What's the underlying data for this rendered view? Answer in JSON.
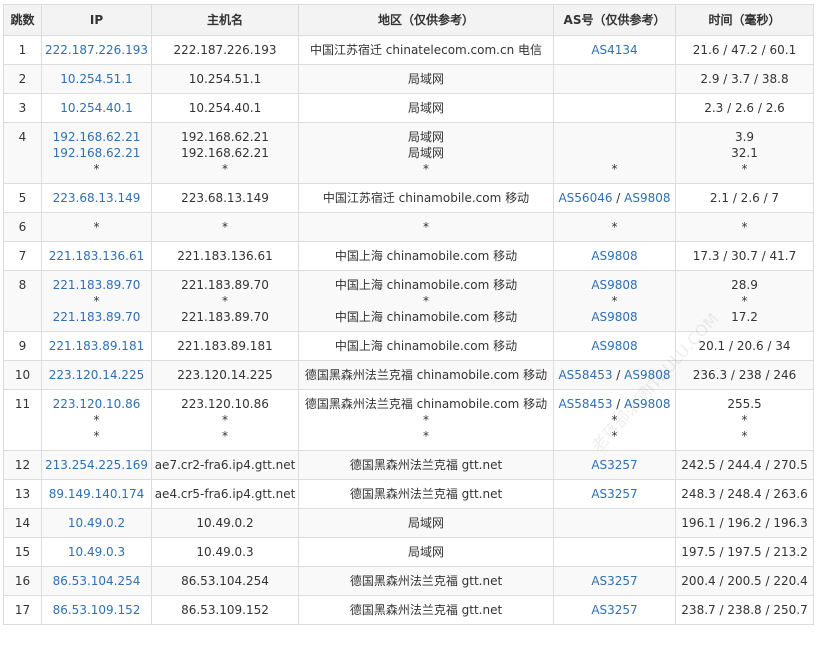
{
  "headers": [
    "跳数",
    "IP",
    "主机名",
    "地区（仅供参考）",
    "AS号（仅供参考）",
    "时间（毫秒）"
  ],
  "rows": [
    {
      "hop": "1",
      "ip": [
        "222.187.226.193"
      ],
      "host": [
        "222.187.226.193"
      ],
      "region": [
        "中国江苏宿迁 chinatelecom.com.cn 电信"
      ],
      "as": [
        [
          "AS4134"
        ]
      ],
      "time": [
        "21.6 / 47.2 / 60.1"
      ]
    },
    {
      "hop": "2",
      "ip": [
        "10.254.51.1"
      ],
      "host": [
        "10.254.51.1"
      ],
      "region": [
        "局域网"
      ],
      "as": [
        []
      ],
      "time": [
        "2.9 / 3.7 / 38.8"
      ]
    },
    {
      "hop": "3",
      "ip": [
        "10.254.40.1"
      ],
      "host": [
        "10.254.40.1"
      ],
      "region": [
        "局域网"
      ],
      "as": [
        []
      ],
      "time": [
        "2.3 / 2.6 / 2.6"
      ]
    },
    {
      "hop": "4",
      "ip": [
        "192.168.62.21",
        "192.168.62.21",
        "*"
      ],
      "host": [
        "192.168.62.21",
        "192.168.62.21",
        "*"
      ],
      "region": [
        "局域网",
        "局域网",
        "*"
      ],
      "as": [
        [],
        [],
        [
          "*"
        ]
      ],
      "time": [
        "3.9",
        "32.1",
        "*"
      ]
    },
    {
      "hop": "5",
      "ip": [
        "223.68.13.149"
      ],
      "host": [
        "223.68.13.149"
      ],
      "region": [
        "中国江苏宿迁 chinamobile.com 移动"
      ],
      "as": [
        [
          "AS56046",
          "AS9808"
        ]
      ],
      "time": [
        "2.1 / 2.6 / 7"
      ]
    },
    {
      "hop": "6",
      "ip": [
        "*"
      ],
      "host": [
        "*"
      ],
      "region": [
        "*"
      ],
      "as": [
        [
          "*"
        ]
      ],
      "time": [
        "*"
      ]
    },
    {
      "hop": "7",
      "ip": [
        "221.183.136.61"
      ],
      "host": [
        "221.183.136.61"
      ],
      "region": [
        "中国上海 chinamobile.com 移动"
      ],
      "as": [
        [
          "AS9808"
        ]
      ],
      "time": [
        "17.3 / 30.7 / 41.7"
      ]
    },
    {
      "hop": "8",
      "ip": [
        "221.183.89.70",
        "*",
        "221.183.89.70"
      ],
      "host": [
        "221.183.89.70",
        "*",
        "221.183.89.70"
      ],
      "region": [
        "中国上海 chinamobile.com 移动",
        "*",
        "中国上海 chinamobile.com 移动"
      ],
      "as": [
        [
          "AS9808"
        ],
        [
          "*"
        ],
        [
          "AS9808"
        ]
      ],
      "time": [
        "28.9",
        "*",
        "17.2"
      ]
    },
    {
      "hop": "9",
      "ip": [
        "221.183.89.181"
      ],
      "host": [
        "221.183.89.181"
      ],
      "region": [
        "中国上海 chinamobile.com 移动"
      ],
      "as": [
        [
          "AS9808"
        ]
      ],
      "time": [
        "20.1 / 20.6 / 34"
      ]
    },
    {
      "hop": "10",
      "ip": [
        "223.120.14.225"
      ],
      "host": [
        "223.120.14.225"
      ],
      "region": [
        "德国黑森州法兰克福 chinamobile.com 移动"
      ],
      "as": [
        [
          "AS58453",
          "AS9808"
        ]
      ],
      "time": [
        "236.3 / 238 / 246"
      ]
    },
    {
      "hop": "11",
      "ip": [
        "223.120.10.86",
        "*",
        "*"
      ],
      "host": [
        "223.120.10.86",
        "*",
        "*"
      ],
      "region": [
        "德国黑森州法兰克福 chinamobile.com 移动",
        "*",
        "*"
      ],
      "as": [
        [
          "AS58453",
          "AS9808"
        ],
        [
          "*"
        ],
        [
          "*"
        ]
      ],
      "time": [
        "255.5",
        "*",
        "*"
      ]
    },
    {
      "hop": "12",
      "ip": [
        "213.254.225.169"
      ],
      "host": [
        "ae7.cr2-fra6.ip4.gtt.net"
      ],
      "region": [
        "德国黑森州法兰克福 gtt.net"
      ],
      "as": [
        [
          "AS3257"
        ]
      ],
      "time": [
        "242.5 / 244.4 / 270.5"
      ]
    },
    {
      "hop": "13",
      "ip": [
        "89.149.140.174"
      ],
      "host": [
        "ae4.cr5-fra6.ip4.gtt.net"
      ],
      "region": [
        "德国黑森州法兰克福 gtt.net"
      ],
      "as": [
        [
          "AS3257"
        ]
      ],
      "time": [
        "248.3 / 248.4 / 263.6"
      ]
    },
    {
      "hop": "14",
      "ip": [
        "10.49.0.2"
      ],
      "host": [
        "10.49.0.2"
      ],
      "region": [
        "局域网"
      ],
      "as": [
        []
      ],
      "time": [
        "196.1 / 196.2 / 196.3"
      ]
    },
    {
      "hop": "15",
      "ip": [
        "10.49.0.3"
      ],
      "host": [
        "10.49.0.3"
      ],
      "region": [
        "局域网"
      ],
      "as": [
        []
      ],
      "time": [
        "197.5 / 197.5 / 213.2"
      ]
    },
    {
      "hop": "16",
      "ip": [
        "86.53.104.254"
      ],
      "host": [
        "86.53.104.254"
      ],
      "region": [
        "德国黑森州法兰克福 gtt.net"
      ],
      "as": [
        [
          "AS3257"
        ]
      ],
      "time": [
        "200.4 / 200.5 / 220.4"
      ]
    },
    {
      "hop": "17",
      "ip": [
        "86.53.109.152"
      ],
      "host": [
        "86.53.109.152"
      ],
      "region": [
        "德国黑森州法兰克福 gtt.net"
      ],
      "as": [
        [
          "AS3257"
        ]
      ],
      "time": [
        "238.7 / 238.8 / 250.7"
      ]
    }
  ],
  "watermark": "老蒋部落网ITBULU.COM",
  "colors": {
    "link": "#2f6fb3",
    "header_bg": "#f3f3f3",
    "border": "#dcdcdc"
  }
}
